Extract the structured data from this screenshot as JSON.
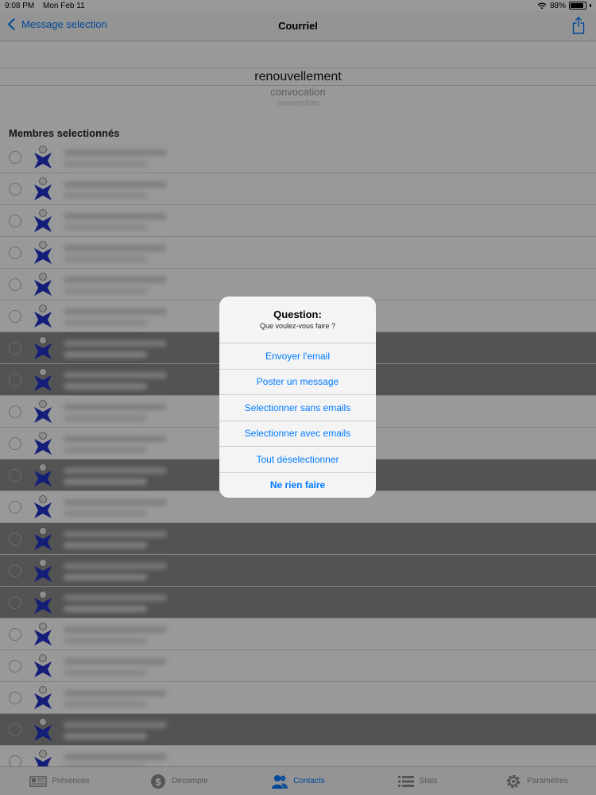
{
  "status_bar": {
    "time": "9:08 PM",
    "date": "Mon Feb 11",
    "battery": "88%"
  },
  "nav": {
    "back_label": "Message selection",
    "title": "Courriel",
    "share_icon": "share-icon"
  },
  "picker": {
    "selected": "renouvellement",
    "next": "convocation",
    "next2": "sequestion"
  },
  "section_header": "Membres selectionnés",
  "member_rows": [
    {
      "dark": false
    },
    {
      "dark": false
    },
    {
      "dark": false
    },
    {
      "dark": false
    },
    {
      "dark": false
    },
    {
      "dark": false
    },
    {
      "dark": true
    },
    {
      "dark": true
    },
    {
      "dark": false
    },
    {
      "dark": false
    },
    {
      "dark": true
    },
    {
      "dark": false
    },
    {
      "dark": true
    },
    {
      "dark": true
    },
    {
      "dark": true
    },
    {
      "dark": false
    },
    {
      "dark": false
    },
    {
      "dark": false
    },
    {
      "dark": true
    },
    {
      "dark": false
    }
  ],
  "dialog": {
    "title": "Question:",
    "message": "Que voulez-vous faire ?",
    "actions": [
      {
        "label": "Envoyer l'email"
      },
      {
        "label": "Poster un message"
      },
      {
        "label": "Selectionner sans emails"
      },
      {
        "label": "Selectionner avec emails"
      },
      {
        "label": "Tout déselectionner"
      }
    ],
    "cancel_label": "Ne rien faire"
  },
  "tabs": [
    {
      "label": "Présences",
      "icon": "presence-icon",
      "active": false
    },
    {
      "label": "Décompte",
      "icon": "dollar-icon",
      "active": false
    },
    {
      "label": "Contacts",
      "icon": "contacts-icon",
      "active": true
    },
    {
      "label": "Stats",
      "icon": "list-icon",
      "active": false
    },
    {
      "label": "Paramètres",
      "icon": "gear-icon",
      "active": false
    }
  ],
  "colors": {
    "accent": "#007aff",
    "row_dark": "#8a8a8a",
    "avatar_blue": "#2232c8"
  }
}
